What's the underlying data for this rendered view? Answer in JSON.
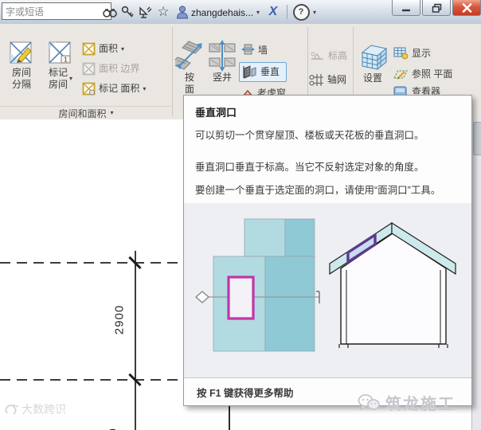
{
  "glyphs": {
    "caret": "▾",
    "star": "☆",
    "help": "?",
    "x_logo": "X",
    "one": "1"
  },
  "titlebar": {
    "search_value": "字或短语",
    "username": "zhangdehais..."
  },
  "ribbon": {
    "room_area": {
      "room_separator": [
        "房间",
        "分隔"
      ],
      "tag_room": [
        "标记",
        "房间"
      ],
      "area": "面积",
      "area_boundary": "面积 边界",
      "tag_area": "标记 面积",
      "panel_label": "房间和面积"
    },
    "opening": {
      "by_face": [
        "按",
        "面"
      ],
      "shaft": "竖井",
      "wall": "墙",
      "vertical": "垂直",
      "dormer": "老虎窗"
    },
    "datum": {
      "level": "标高",
      "grid": "轴网"
    },
    "work_plane": {
      "set": "设置",
      "show": "显示",
      "ref_plane": "参照 平面",
      "viewer": "查看器"
    }
  },
  "tooltip": {
    "title": "垂直洞口",
    "para1": "可以剪切一个贯穿屋顶、楼板或天花板的垂直洞口。",
    "para2": "垂直洞口垂直于标高。当它不反射选定对象的角度。",
    "para3": "要创建一个垂直于选定面的洞口，请使用“面洞口”工具。",
    "footer": "按 F1 键获得更多帮助"
  },
  "drawing": {
    "dimension": "2900",
    "dimension_partial": "0"
  },
  "watermarks": {
    "left": "大数跨识",
    "right": "筑龙施工"
  },
  "colors": {
    "teal_light": "#b2dae1",
    "teal_dark": "#8fc9d5",
    "magenta": "#c433aa",
    "purple": "#5d3a8e",
    "roof": "#cde9ec",
    "highlight_border": "#6da6d8",
    "close_red": "#c23c24"
  }
}
